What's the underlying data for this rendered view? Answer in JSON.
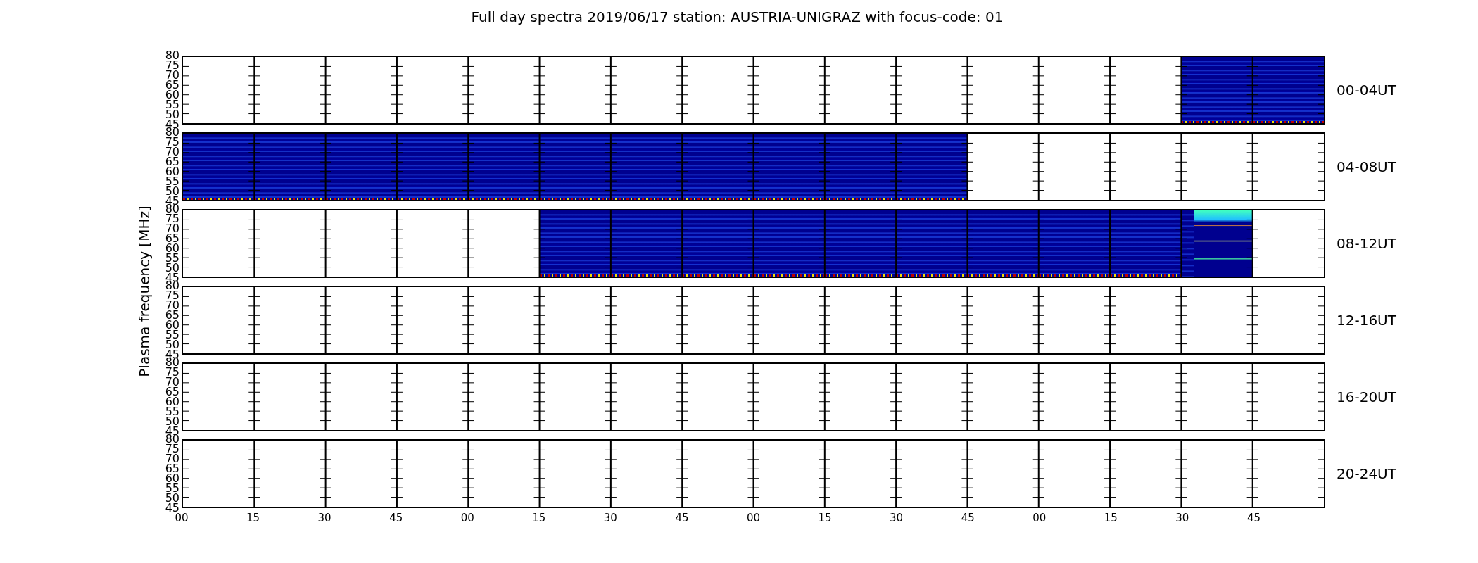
{
  "title": "Full day spectra 2019/06/17 station: AUSTRIA-UNIGRAZ with focus-code: 01",
  "ylabel": "Plasma frequency [MHz]",
  "xticks": [
    "00",
    "15",
    "30",
    "45",
    "00",
    "15",
    "30",
    "45",
    "00",
    "15",
    "30",
    "45",
    "00",
    "15",
    "30",
    "45"
  ],
  "panels": [
    {
      "label": "00-04UT",
      "yticks": [
        "80",
        "75",
        "70",
        "65",
        "60",
        "55",
        "50",
        "45"
      ],
      "cells": [
        {
          "kind": "empty"
        },
        {
          "kind": "empty"
        },
        {
          "kind": "empty"
        },
        {
          "kind": "empty"
        },
        {
          "kind": "empty"
        },
        {
          "kind": "empty"
        },
        {
          "kind": "empty"
        },
        {
          "kind": "empty"
        },
        {
          "kind": "empty"
        },
        {
          "kind": "empty"
        },
        {
          "kind": "empty"
        },
        {
          "kind": "empty"
        },
        {
          "kind": "empty"
        },
        {
          "kind": "empty"
        },
        {
          "kind": "spectrum"
        },
        {
          "kind": "spectrum"
        }
      ]
    },
    {
      "label": "04-08UT",
      "yticks": [
        "80",
        "75",
        "70",
        "65",
        "60",
        "55",
        "50",
        "45"
      ],
      "cells": [
        {
          "kind": "spectrum"
        },
        {
          "kind": "spectrum"
        },
        {
          "kind": "spectrum"
        },
        {
          "kind": "spectrum"
        },
        {
          "kind": "spectrum"
        },
        {
          "kind": "spectrum"
        },
        {
          "kind": "spectrum"
        },
        {
          "kind": "spectrum"
        },
        {
          "kind": "spectrum"
        },
        {
          "kind": "spectrum"
        },
        {
          "kind": "spectrum"
        },
        {
          "kind": "empty"
        },
        {
          "kind": "empty"
        },
        {
          "kind": "empty"
        },
        {
          "kind": "empty"
        },
        {
          "kind": "empty"
        }
      ]
    },
    {
      "label": "08-12UT",
      "yticks": [
        "80",
        "75",
        "70",
        "65",
        "60",
        "55",
        "50",
        "45"
      ],
      "cells": [
        {
          "kind": "empty"
        },
        {
          "kind": "empty"
        },
        {
          "kind": "empty"
        },
        {
          "kind": "empty"
        },
        {
          "kind": "empty"
        },
        {
          "kind": "spectrum"
        },
        {
          "kind": "spectrum"
        },
        {
          "kind": "spectrum"
        },
        {
          "kind": "spectrum"
        },
        {
          "kind": "spectrum"
        },
        {
          "kind": "spectrum"
        },
        {
          "kind": "spectrum"
        },
        {
          "kind": "spectrum"
        },
        {
          "kind": "spectrum"
        },
        {
          "kind": "band"
        },
        {
          "kind": "empty"
        }
      ]
    },
    {
      "label": "12-16UT",
      "yticks": [
        "80",
        "75",
        "70",
        "65",
        "60",
        "55",
        "50",
        "45"
      ],
      "cells": [
        {
          "kind": "empty"
        },
        {
          "kind": "empty"
        },
        {
          "kind": "empty"
        },
        {
          "kind": "empty"
        },
        {
          "kind": "empty"
        },
        {
          "kind": "empty"
        },
        {
          "kind": "empty"
        },
        {
          "kind": "empty"
        },
        {
          "kind": "empty"
        },
        {
          "kind": "empty"
        },
        {
          "kind": "empty"
        },
        {
          "kind": "empty"
        },
        {
          "kind": "empty"
        },
        {
          "kind": "empty"
        },
        {
          "kind": "empty"
        },
        {
          "kind": "empty"
        }
      ]
    },
    {
      "label": "16-20UT",
      "yticks": [
        "80",
        "75",
        "70",
        "65",
        "60",
        "55",
        "50",
        "45"
      ],
      "cells": [
        {
          "kind": "empty"
        },
        {
          "kind": "empty"
        },
        {
          "kind": "empty"
        },
        {
          "kind": "empty"
        },
        {
          "kind": "empty"
        },
        {
          "kind": "empty"
        },
        {
          "kind": "empty"
        },
        {
          "kind": "empty"
        },
        {
          "kind": "empty"
        },
        {
          "kind": "empty"
        },
        {
          "kind": "empty"
        },
        {
          "kind": "empty"
        },
        {
          "kind": "empty"
        },
        {
          "kind": "empty"
        },
        {
          "kind": "empty"
        },
        {
          "kind": "empty"
        }
      ]
    },
    {
      "label": "20-24UT",
      "yticks": [
        "80",
        "75",
        "70",
        "65",
        "60",
        "55",
        "50",
        "45"
      ],
      "cells": [
        {
          "kind": "empty"
        },
        {
          "kind": "empty"
        },
        {
          "kind": "empty"
        },
        {
          "kind": "empty"
        },
        {
          "kind": "empty"
        },
        {
          "kind": "empty"
        },
        {
          "kind": "empty"
        },
        {
          "kind": "empty"
        },
        {
          "kind": "empty"
        },
        {
          "kind": "empty"
        },
        {
          "kind": "empty"
        },
        {
          "kind": "empty"
        },
        {
          "kind": "empty"
        },
        {
          "kind": "empty"
        },
        {
          "kind": "empty"
        },
        {
          "kind": "empty"
        }
      ]
    }
  ]
}
